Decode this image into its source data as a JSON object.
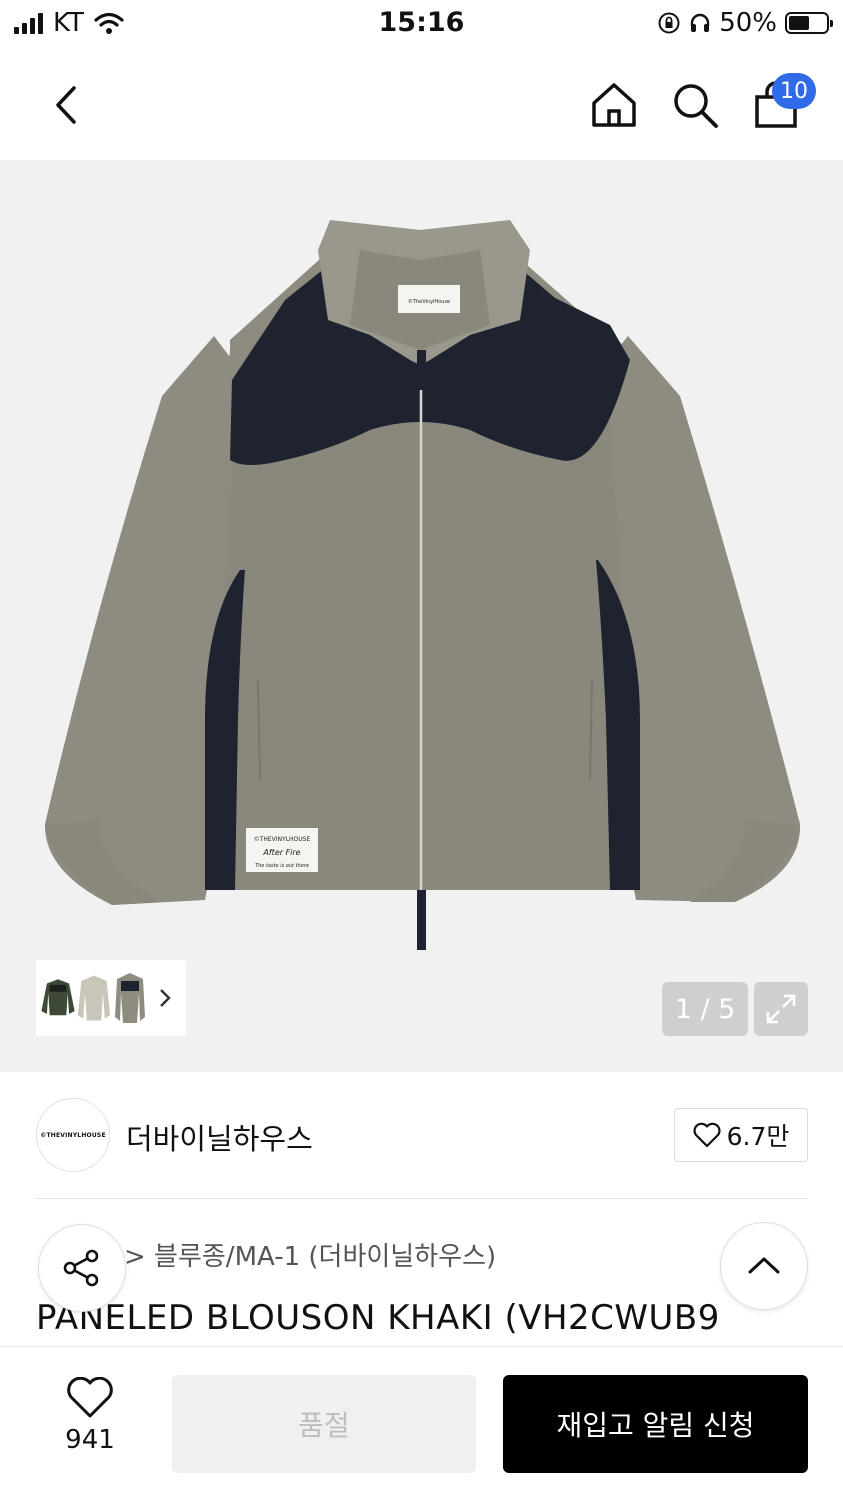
{
  "status_bar": {
    "carrier": "KT",
    "time": "15:16",
    "battery": "50%",
    "battery_level": 0.5
  },
  "nav": {
    "cart_count": "10"
  },
  "gallery": {
    "counter": "1 / 5",
    "product_label_lines": [
      "©THEVINYLHOUSE",
      "After Fire",
      "The taste is out there"
    ],
    "collar_tag": "©TheVinylHouse"
  },
  "brand": {
    "logo_text": "©THEVINYLHOUSE",
    "name": "더바이닐하우스",
    "likes": "6.7만"
  },
  "breadcrumb": "> 블루종/MA-1 (더바이닐하우스)",
  "product": {
    "title": "PANELED BLOUSON KHAKI (VH2CWUB9"
  },
  "bottom": {
    "wish_count": "941",
    "soldout_label": "품절",
    "restock_label": "재입고 알림 신청"
  },
  "colors": {
    "accent_badge": "#2f6ae8",
    "jacket_khaki": "#8e8c80",
    "jacket_navy": "#1f2330"
  }
}
